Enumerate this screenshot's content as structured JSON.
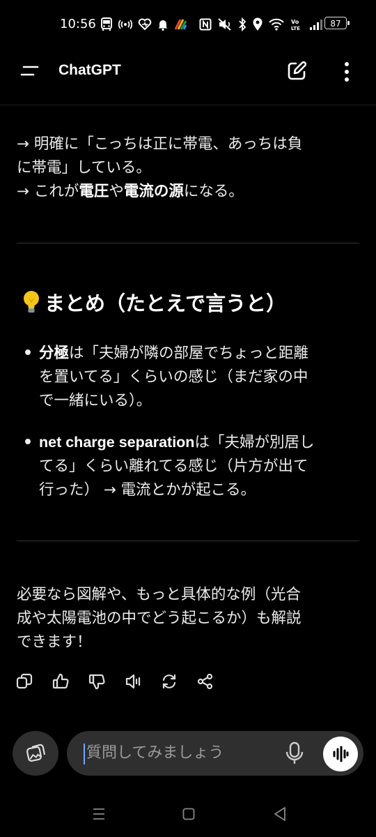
{
  "status_bar": {
    "time": "10:56",
    "battery": "87",
    "left_icons": [
      "bus-icon",
      "nfc-pay-icon",
      "heart-icon",
      "bell-icon",
      "color-app-icon"
    ],
    "right_icons": [
      "nfc-icon",
      "mute-icon",
      "bluetooth-icon",
      "location-icon",
      "wifi-icon",
      "volte-icon",
      "signal-icon"
    ]
  },
  "header": {
    "title": "ChatGPT"
  },
  "message": {
    "p1_line1": "→ 明確に「こっちは正に帯電、あっちは負",
    "p1_line2": "に帯電」している。",
    "p2_prefix": "→ これが",
    "p2_bold1": "電圧",
    "p2_mid": "や",
    "p2_bold2": "電流の源",
    "p2_suffix": "になる。",
    "heading": "まとめ（たとえで言うと）",
    "bullet1_bold": "分極",
    "bullet1_line1_rest": "は「夫婦が隣の部屋でちょっと距離",
    "bullet1_line2": "を置いてる」くらいの感じ（まだ家の中",
    "bullet1_line3": "で一緒にいる）。",
    "bullet2_bold": "net charge separation",
    "bullet2_line1_rest": "は「夫婦が別居し",
    "bullet2_line2": "てる」くらい離れてる感じ（片方が出て",
    "bullet2_line3": "行った） → 電流とかが起こる。",
    "closing_line1": "必要なら図解や、もっと具体的な例（光合",
    "closing_line2": "成や太陽電池の中でどう起こるか）も解説",
    "closing_line3": "できます！"
  },
  "actions": [
    "copy-icon",
    "thumbs-up-icon",
    "thumbs-down-icon",
    "read-aloud-icon",
    "regenerate-icon",
    "share-icon"
  ],
  "composer": {
    "placeholder": "質問してみましょう"
  },
  "colors": {
    "background": "#000000",
    "text": "#ececec",
    "composer_bg": "#2f2f2f",
    "caret": "#6ea8ff"
  }
}
